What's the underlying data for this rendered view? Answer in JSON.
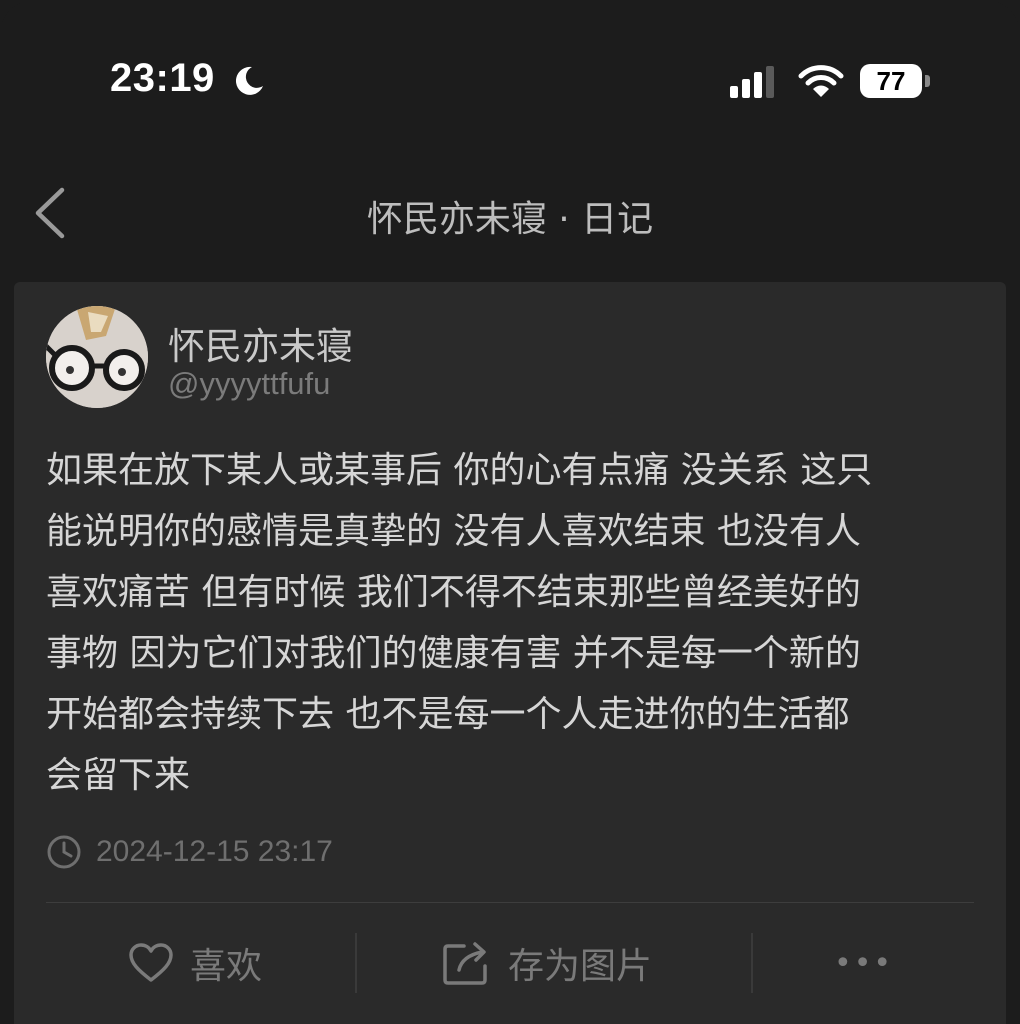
{
  "status_bar": {
    "time": "23:19",
    "battery_level": "77",
    "icons": [
      "moon-icon",
      "signal-icon",
      "wifi-icon",
      "battery-icon"
    ]
  },
  "nav": {
    "back_icon": "chevron-left-icon",
    "title": "怀民亦未寝 · 日记"
  },
  "post": {
    "author_name": "怀民亦未寝",
    "author_handle": "@yyyyttfufu",
    "body_lines": [
      "如果在放下某人或某事后 你的心有点痛 没关系 这只",
      "能说明你的感情是真挚的 没有人喜欢结束 也没有人",
      "喜欢痛苦 但有时候 我们不得不结束那些曾经美好的",
      "事物 因为它们对我们的健康有害 并不是每一个新的",
      "开始都会持续下去 也不是每一个人走进你的生活都",
      "会留下来"
    ],
    "timestamp": "2024-12-15 23:17"
  },
  "actions": {
    "like_label": "喜欢",
    "save_label": "存为图片",
    "more_label": "•••"
  },
  "colors": {
    "background": "#1c1c1c",
    "card": "#2a2a2a",
    "text_primary": "#d6d6d6",
    "text_muted": "#7a7a7a"
  }
}
